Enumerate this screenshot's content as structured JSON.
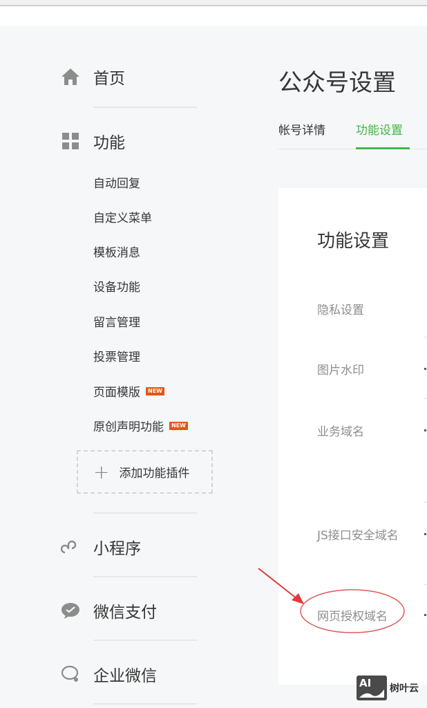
{
  "sidebar": {
    "home": "首页",
    "functions": "功能",
    "sub_items": [
      "自动回复",
      "自定义菜单",
      "模板消息",
      "设备功能",
      "留言管理",
      "投票管理",
      "页面模版",
      "原创声明功能"
    ],
    "new_badge": "NEW",
    "add_plugin": "添加功能插件",
    "mini_program": "小程序",
    "wechat_pay": "微信支付",
    "wework": "企业微信"
  },
  "main": {
    "title": "公众号设置",
    "tabs": [
      {
        "label": "帐号详情"
      },
      {
        "label": "功能设置"
      }
    ],
    "active_tab": "功能设置",
    "accent_color": "#44b549",
    "card_title": "功能设置",
    "rows": [
      "隐私设置",
      "图片水印",
      "业务域名",
      "JS接口安全域名",
      "网页授权域名"
    ]
  },
  "watermark": {
    "brand": "树叶云",
    "logo": "AI"
  }
}
